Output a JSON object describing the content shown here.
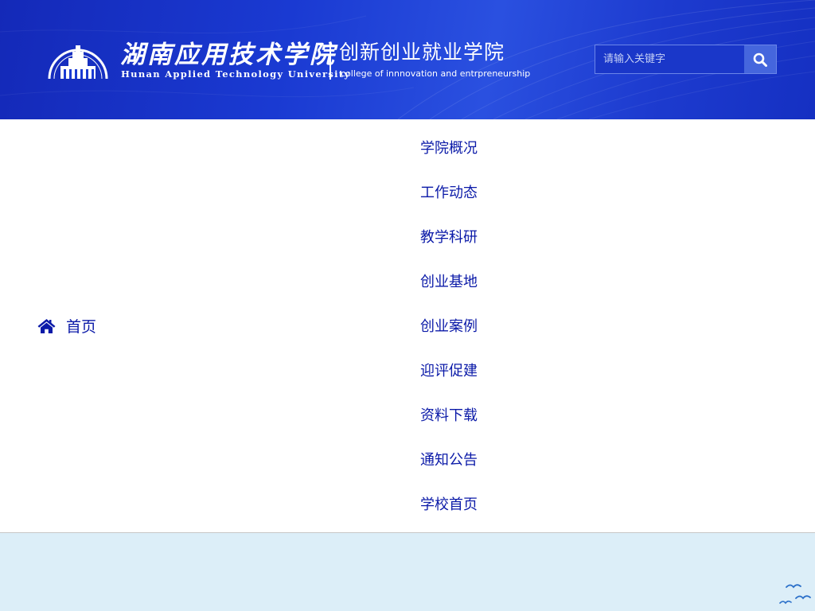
{
  "header": {
    "school_name": "湖南应用技术学院",
    "school_name_en": "Hunan Applied Technology University",
    "college_name": "创新创业就业学院",
    "college_name_en": "college of innnovation and entrpreneurship",
    "logo_icon": "school-emblem-icon"
  },
  "search": {
    "placeholder": "请输入关键字",
    "value": "",
    "icon": "search-icon"
  },
  "home": {
    "label": "首页",
    "icon": "home-icon"
  },
  "nav": {
    "items": [
      {
        "label": "学院概况"
      },
      {
        "label": "工作动态"
      },
      {
        "label": "教学科研"
      },
      {
        "label": "创业基地"
      },
      {
        "label": "创业案例"
      },
      {
        "label": "迎评促建"
      },
      {
        "label": "资料下载"
      },
      {
        "label": "通知公告"
      },
      {
        "label": "学校首页"
      }
    ]
  },
  "colors": {
    "header_bg": "#1a3ad2",
    "link": "#0b1aa8",
    "footer_bg": "#dceef8",
    "search_button": "#4566dd"
  },
  "footer": {
    "decoration_icon": "seagulls-icon"
  }
}
